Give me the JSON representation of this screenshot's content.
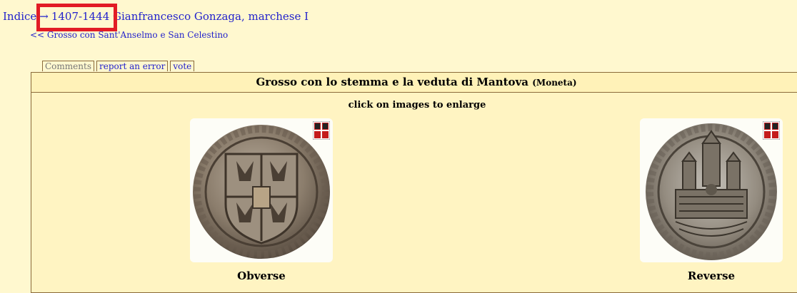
{
  "breadcrumb": {
    "home": "Indice",
    "separator": "→",
    "current": "1407-1444 Gianfrancesco Gonzaga, marchese I"
  },
  "prev_link": "<< Grosso con Sant'Anselmo e San Celestino",
  "tabs": [
    {
      "label": "Comments",
      "active": true
    },
    {
      "label": "report an error",
      "active": false
    },
    {
      "label": "vote",
      "active": false
    }
  ],
  "coin": {
    "title": "Grosso con lo stemma e la veduta di Mantova",
    "type": "(Moneta)",
    "hint": "click on images to enlarge",
    "obverse_label": "Obverse",
    "reverse_label": "Reverse"
  },
  "colors": {
    "background": "#fff8cf",
    "link": "#2222cc",
    "highlight": "#e21c25"
  }
}
